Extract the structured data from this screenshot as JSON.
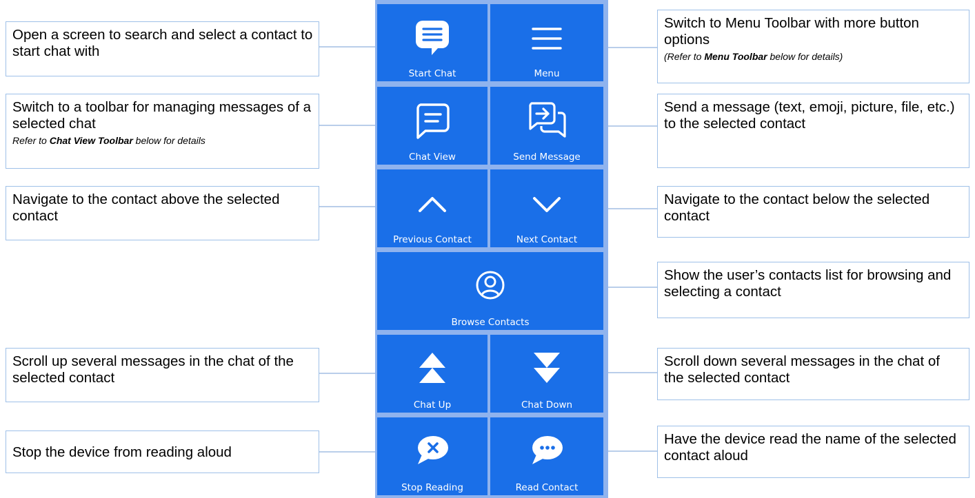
{
  "colors": {
    "button_bg": "#1a6fe8",
    "panel_bg": "#8fb3ee",
    "callout_border": "#9ec0e8",
    "connector": "#8fb0dd"
  },
  "buttons": [
    {
      "id": "start-chat",
      "label": "Start Chat",
      "icon": "speech-bubble-lines-icon"
    },
    {
      "id": "menu",
      "label": "Menu",
      "icon": "hamburger-menu-icon"
    },
    {
      "id": "chat-view",
      "label": "Chat View",
      "icon": "chat-outline-icon"
    },
    {
      "id": "send-message",
      "label": "Send Message",
      "icon": "send-message-icon"
    },
    {
      "id": "previous-contact",
      "label": "Previous Contact",
      "icon": "chevron-up-icon"
    },
    {
      "id": "next-contact",
      "label": "Next Contact",
      "icon": "chevron-down-icon"
    },
    {
      "id": "browse-contacts",
      "label": "Browse Contacts",
      "icon": "person-circle-icon"
    },
    {
      "id": "chat-up",
      "label": "Chat Up",
      "icon": "double-arrow-up-icon"
    },
    {
      "id": "chat-down",
      "label": "Chat Down",
      "icon": "double-arrow-down-icon"
    },
    {
      "id": "stop-reading",
      "label": "Stop Reading",
      "icon": "stop-reading-bubble-icon"
    },
    {
      "id": "read-contact",
      "label": "Read Contact",
      "icon": "ellipsis-bubble-icon"
    }
  ],
  "callouts": {
    "start_chat": {
      "text": "Open a screen to search and select a contact to start chat with"
    },
    "chat_view": {
      "text": "Switch to a toolbar for managing messages of a selected chat",
      "note_prefix": "Refer to ",
      "note_bold": "Chat View Toolbar",
      "note_suffix": " below for details"
    },
    "previous_contact": {
      "text": "Navigate to the contact above the selected contact"
    },
    "chat_up": {
      "text": "Scroll up several messages in the chat of the selected contact"
    },
    "stop_reading": {
      "text": "Stop the device from reading aloud"
    },
    "menu": {
      "text": "Switch to Menu Toolbar with more button options",
      "note_prefix": "(Refer to ",
      "note_bold": "Menu Toolbar",
      "note_suffix": " below for details)"
    },
    "send_message": {
      "text": "Send a message (text, emoji, picture, file, etc.) to the selected contact"
    },
    "next_contact": {
      "text": "Navigate to the contact below the selected contact"
    },
    "browse_contacts": {
      "text": "Show the user’s contacts list for browsing and selecting a contact"
    },
    "chat_down": {
      "text": "Scroll down several messages in the chat of the selected contact"
    },
    "read_contact": {
      "text": "Have the device read the name of the selected contact aloud"
    }
  }
}
